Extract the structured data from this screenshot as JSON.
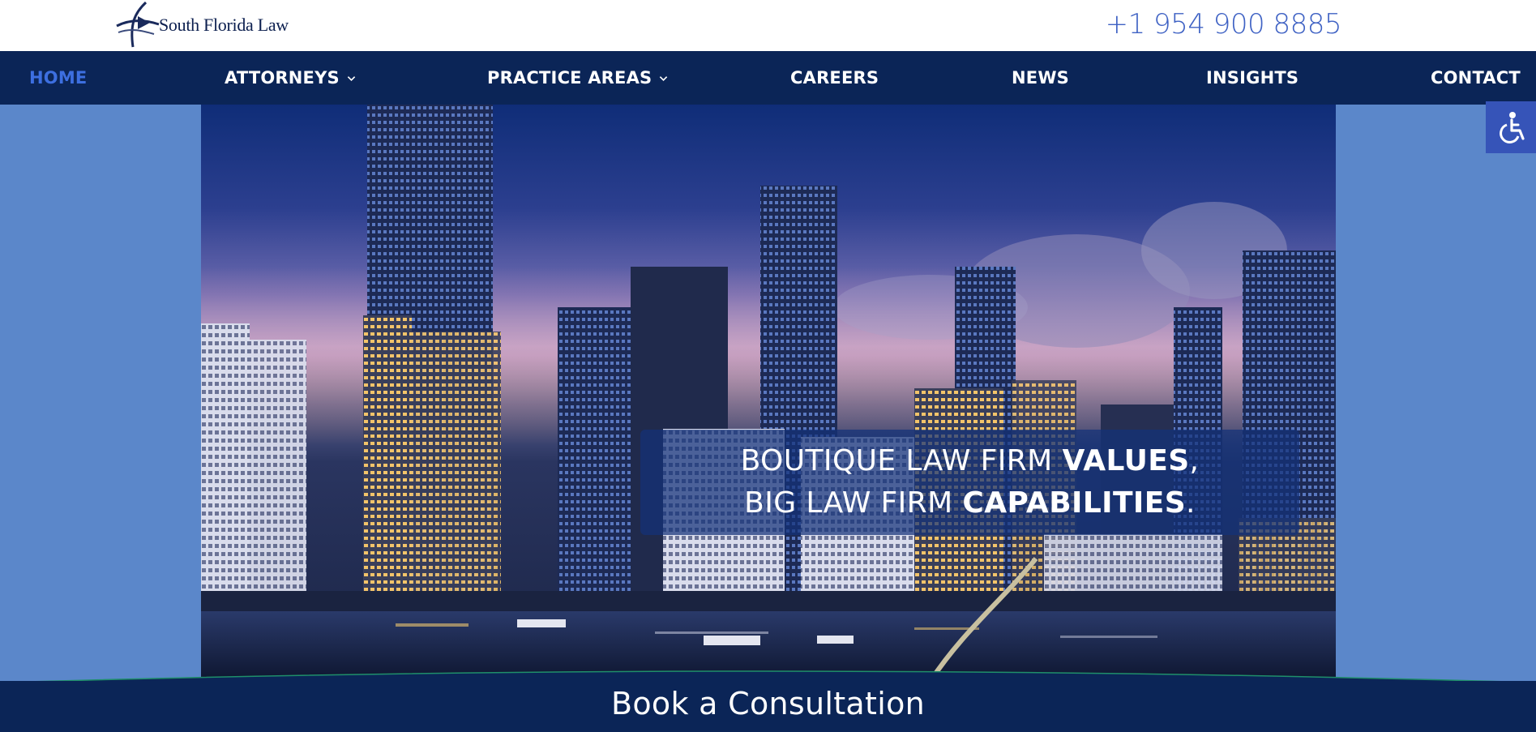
{
  "header": {
    "logo_text": "South Florida Law",
    "phone": "+1 954 900 8885"
  },
  "nav": {
    "items": [
      {
        "label": "HOME",
        "active": true
      },
      {
        "label": "ATTORNEYS",
        "dropdown": true
      },
      {
        "label": "PRACTICE AREAS",
        "dropdown": true
      },
      {
        "label": "CAREERS"
      },
      {
        "label": "NEWS"
      },
      {
        "label": "INSIGHTS"
      },
      {
        "label": "CONTACT"
      }
    ]
  },
  "hero": {
    "line1_prefix": "BOUTIQUE LAW FIRM ",
    "line1_bold": "VALUES",
    "line1_suffix": ",",
    "line2_prefix": "BIG LAW FIRM ",
    "line2_bold": "CAPABILITIES",
    "line2_suffix": "."
  },
  "cta": {
    "label": "Book a Consultation"
  },
  "accessibility": {
    "icon": "wheelchair-icon"
  },
  "colors": {
    "nav_bg": "#0b2557",
    "nav_active": "#3d6fe0",
    "phone": "#3f62c4",
    "page_bg": "#5b87ca",
    "a11y_bg": "#3654b8"
  }
}
